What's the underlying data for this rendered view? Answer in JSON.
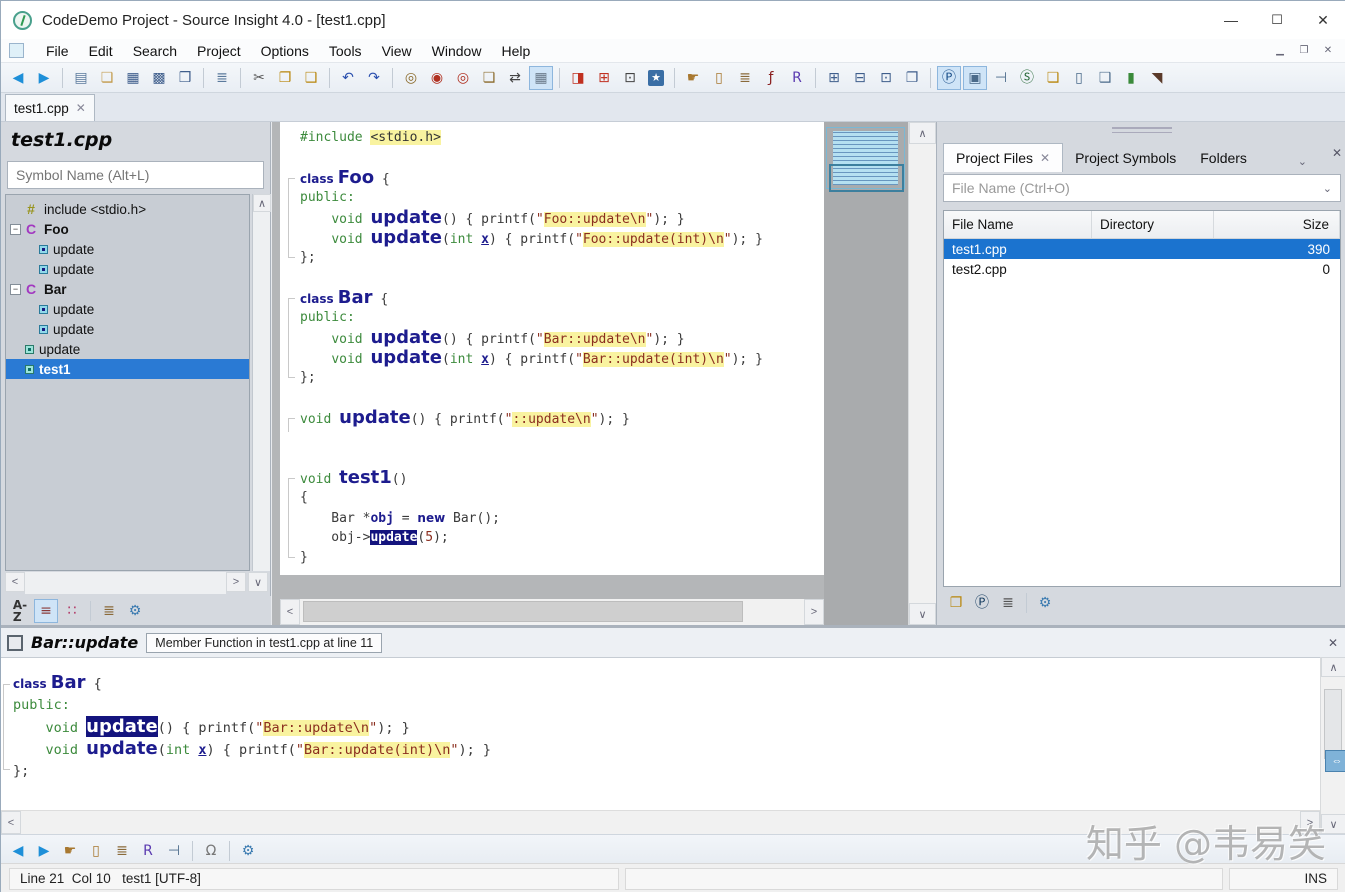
{
  "window": {
    "title": "CodeDemo Project - Source Insight 4.0 - [test1.cpp]",
    "minimize": "—",
    "maximize": "❐",
    "close": "✕",
    "mdi_minimize": "▁",
    "mdi_restore": "❐",
    "mdi_close": "✕"
  },
  "menu": {
    "items": [
      "File",
      "Edit",
      "Search",
      "Project",
      "Options",
      "Tools",
      "View",
      "Window",
      "Help"
    ]
  },
  "toolbar": {
    "items": [
      {
        "n": "nav-back",
        "g": "◀",
        "c": "#1e8fd8"
      },
      {
        "n": "nav-forward",
        "g": "▶",
        "c": "#1e8fd8"
      },
      {
        "sep": true
      },
      {
        "n": "new-file",
        "g": "▤",
        "c": "#5b7a9c"
      },
      {
        "n": "open-file",
        "g": "❏",
        "c": "#c29a4a"
      },
      {
        "n": "save",
        "g": "▦",
        "c": "#3f5e8c"
      },
      {
        "n": "save-as",
        "g": "▩",
        "c": "#3f5e8c"
      },
      {
        "n": "save-all",
        "g": "❒",
        "c": "#3f5e8c"
      },
      {
        "sep": true
      },
      {
        "n": "print",
        "g": "≣",
        "c": "#5b7a9c"
      },
      {
        "sep": true
      },
      {
        "n": "cut",
        "g": "✂",
        "c": "#555555"
      },
      {
        "n": "copy",
        "g": "❐",
        "c": "#b8860b"
      },
      {
        "n": "paste",
        "g": "❑",
        "c": "#b8860b"
      },
      {
        "sep": true
      },
      {
        "n": "undo",
        "g": "↶",
        "c": "#2a4fae"
      },
      {
        "n": "redo",
        "g": "↷",
        "c": "#2a4fae"
      },
      {
        "sep": true
      },
      {
        "n": "search",
        "g": "◎",
        "c": "#8a6a2a"
      },
      {
        "n": "search-forward",
        "g": "◉",
        "c": "#b03020"
      },
      {
        "n": "search-backward",
        "g": "◎",
        "c": "#b03020"
      },
      {
        "n": "search-files",
        "g": "❏",
        "c": "#8a6a2a"
      },
      {
        "n": "replace",
        "g": "⇄",
        "c": "#444444"
      },
      {
        "n": "search-project",
        "g": "▦",
        "c": "#6a7a8a",
        "pr": true
      },
      {
        "sep": true
      },
      {
        "n": "compare-files",
        "g": "◨",
        "c": "#c03020"
      },
      {
        "n": "jump-to-definition",
        "g": "⊞",
        "c": "#c03020"
      },
      {
        "n": "toggle-pane",
        "g": "⊡",
        "c": "#444444"
      },
      {
        "n": "bookmark",
        "g": "★",
        "c": "#ffffff",
        "bg": "#3a6ea5"
      },
      {
        "sep": true
      },
      {
        "n": "context-jump",
        "g": "☛",
        "c": "#a87830"
      },
      {
        "n": "browse-symbols",
        "g": "▯",
        "c": "#a87830"
      },
      {
        "n": "references",
        "g": "≣",
        "c": "#8a6a3a"
      },
      {
        "n": "function-list",
        "g": "ƒ",
        "c": "#8a2020"
      },
      {
        "n": "relation-window",
        "g": "R",
        "c": "#5a3ab0"
      },
      {
        "sep": true
      },
      {
        "n": "window-tile",
        "g": "⊞",
        "c": "#3f5e8c"
      },
      {
        "n": "window-horizontal",
        "g": "⊟",
        "c": "#3f5e8c"
      },
      {
        "n": "window-split",
        "g": "⊡",
        "c": "#3f5e8c"
      },
      {
        "n": "window-cascade",
        "g": "❐",
        "c": "#3f5e8c"
      },
      {
        "sep": true
      },
      {
        "n": "project-window",
        "g": "Ⓟ",
        "c": "#1a4f8a",
        "pr": true
      },
      {
        "n": "context-window",
        "g": "▣",
        "c": "#4a6a8a",
        "pr": true
      },
      {
        "n": "relation-tree",
        "g": "⊣",
        "c": "#4a6a8a"
      },
      {
        "n": "symbol-window",
        "g": "Ⓢ",
        "c": "#2a6a3a"
      },
      {
        "n": "project-file-browser",
        "g": "❏",
        "c": "#b8860b"
      },
      {
        "n": "help-browser",
        "g": "▯",
        "c": "#4a6a8a"
      },
      {
        "n": "clip-window",
        "g": "❑",
        "c": "#4a6a8a"
      },
      {
        "n": "compile-window",
        "g": "▮",
        "c": "#3a8a3a"
      },
      {
        "n": "macro-run",
        "g": "◥",
        "c": "#5a3a2a"
      }
    ]
  },
  "tabstrip": {
    "active_tab": "test1.cpp",
    "close_glyph": "✕"
  },
  "left_panel": {
    "title": "test1.cpp",
    "search_placeholder": "Symbol Name (Alt+L)",
    "tree": [
      {
        "icon": "include",
        "label": "include <stdio.h>",
        "indent": 1
      },
      {
        "icon": "class",
        "label": "Foo",
        "bold": true,
        "expand": "−",
        "indent": 0
      },
      {
        "icon": "method",
        "label": "update",
        "indent": 2
      },
      {
        "icon": "method",
        "label": "update",
        "indent": 2
      },
      {
        "icon": "class",
        "label": "Bar",
        "bold": true,
        "expand": "−",
        "indent": 0
      },
      {
        "icon": "method",
        "label": "update",
        "indent": 2
      },
      {
        "icon": "method",
        "label": "update",
        "indent": 2
      },
      {
        "icon": "func",
        "label": "update",
        "indent": 1
      },
      {
        "icon": "func",
        "label": "test1",
        "indent": 1,
        "selected": true
      }
    ],
    "footer_icons": [
      {
        "n": "sort-alpha",
        "g": "A-Z",
        "c": "#333333",
        "az": true
      },
      {
        "n": "view-list",
        "g": "≡",
        "c": "#8a3a3a",
        "pr": true
      },
      {
        "n": "view-members",
        "g": "∷",
        "c": "#b03060"
      },
      {
        "sep": true
      },
      {
        "n": "browse-book",
        "g": "≣",
        "c": "#8a6a3a"
      },
      {
        "n": "panel-settings",
        "g": "⚙",
        "c": "#3a7ab0"
      }
    ]
  },
  "editor": {
    "lines": [
      [
        {
          "c": "pre",
          "t": "#include "
        },
        {
          "c": "inc",
          "t": "<stdio.h>"
        }
      ],
      [],
      [
        {
          "c": "kw",
          "t": "class "
        },
        {
          "c": "fn",
          "t": "Foo"
        },
        {
          "c": "p",
          "t": " {"
        }
      ],
      [
        {
          "c": "g",
          "t": "public:"
        }
      ],
      [
        {
          "c": "p",
          "t": "    "
        },
        {
          "c": "g",
          "t": "void "
        },
        {
          "c": "fn",
          "t": "update"
        },
        {
          "c": "p",
          "t": "() { printf("
        },
        {
          "c": "s",
          "t": "\""
        },
        {
          "c": "sy",
          "t": "Foo::update\\n"
        },
        {
          "c": "s",
          "t": "\""
        },
        {
          "c": "p",
          "t": "); }"
        }
      ],
      [
        {
          "c": "p",
          "t": "    "
        },
        {
          "c": "g",
          "t": "void "
        },
        {
          "c": "fn",
          "t": "update"
        },
        {
          "c": "p",
          "t": "("
        },
        {
          "c": "g",
          "t": "int "
        },
        {
          "c": "u",
          "t": "x"
        },
        {
          "c": "p",
          "t": ") { printf("
        },
        {
          "c": "s",
          "t": "\""
        },
        {
          "c": "sy",
          "t": "Foo::update(int)\\n"
        },
        {
          "c": "s",
          "t": "\""
        },
        {
          "c": "p",
          "t": "); }"
        }
      ],
      [
        {
          "c": "p",
          "t": "};"
        }
      ],
      [],
      [
        {
          "c": "kw",
          "t": "class "
        },
        {
          "c": "fn",
          "t": "Bar"
        },
        {
          "c": "p",
          "t": " {"
        }
      ],
      [
        {
          "c": "g",
          "t": "public:"
        }
      ],
      [
        {
          "c": "p",
          "t": "    "
        },
        {
          "c": "g",
          "t": "void "
        },
        {
          "c": "fn",
          "t": "update"
        },
        {
          "c": "p",
          "t": "() { printf("
        },
        {
          "c": "s",
          "t": "\""
        },
        {
          "c": "sy",
          "t": "Bar::update\\n"
        },
        {
          "c": "s",
          "t": "\""
        },
        {
          "c": "p",
          "t": "); }"
        }
      ],
      [
        {
          "c": "p",
          "t": "    "
        },
        {
          "c": "g",
          "t": "void "
        },
        {
          "c": "fn",
          "t": "update"
        },
        {
          "c": "p",
          "t": "("
        },
        {
          "c": "g",
          "t": "int "
        },
        {
          "c": "u",
          "t": "x"
        },
        {
          "c": "p",
          "t": ") { printf("
        },
        {
          "c": "s",
          "t": "\""
        },
        {
          "c": "sy",
          "t": "Bar::update(int)\\n"
        },
        {
          "c": "s",
          "t": "\""
        },
        {
          "c": "p",
          "t": "); }"
        }
      ],
      [
        {
          "c": "p",
          "t": "};"
        }
      ],
      [],
      [
        {
          "c": "g",
          "t": "void "
        },
        {
          "c": "fn",
          "t": "update"
        },
        {
          "c": "p",
          "t": "() { printf("
        },
        {
          "c": "s",
          "t": "\""
        },
        {
          "c": "sy",
          "t": "::update\\n"
        },
        {
          "c": "s",
          "t": "\""
        },
        {
          "c": "p",
          "t": "); }"
        }
      ],
      [],
      [],
      [
        {
          "c": "g",
          "t": "void "
        },
        {
          "c": "fn",
          "t": "test1"
        },
        {
          "c": "p",
          "t": "()"
        }
      ],
      [
        {
          "c": "p",
          "t": "{"
        }
      ],
      [
        {
          "c": "p",
          "t": "    Bar *"
        },
        {
          "c": "b",
          "t": "obj"
        },
        {
          "c": "p",
          "t": " = "
        },
        {
          "c": "kw",
          "t": "new"
        },
        {
          "c": "p",
          "t": " Bar();"
        }
      ],
      [
        {
          "c": "p",
          "t": "    obj->"
        },
        {
          "c": "sel",
          "t": "update"
        },
        {
          "c": "p",
          "t": "("
        },
        {
          "c": "n",
          "t": "5"
        },
        {
          "c": "p",
          "t": ");"
        }
      ],
      [
        {
          "c": "p",
          "t": "}"
        }
      ]
    ]
  },
  "right_panel": {
    "tabs": [
      {
        "label": "Project Files",
        "active": true,
        "closable": true
      },
      {
        "label": "Project Symbols"
      },
      {
        "label": "Folders"
      }
    ],
    "tab_chevron": "⌄",
    "close_glyph": "✕",
    "file_input_placeholder": "File Name (Ctrl+O)",
    "input_chevron": "⌄",
    "table": {
      "columns": [
        "File Name",
        "Directory",
        "Size"
      ],
      "rows": [
        {
          "file": "test1.cpp",
          "dir": "",
          "size": "390",
          "selected": true
        },
        {
          "file": "test2.cpp",
          "dir": "",
          "size": "0"
        }
      ]
    },
    "footer_icons": [
      {
        "n": "open-project",
        "g": "❐",
        "c": "#b8860b"
      },
      {
        "n": "add-project-file",
        "g": "Ⓟ",
        "c": "#123a5e"
      },
      {
        "n": "file-list",
        "g": "≣",
        "c": "#555555"
      },
      {
        "sep": true
      },
      {
        "n": "panel-settings",
        "g": "⚙",
        "c": "#3a7ab0"
      }
    ]
  },
  "context_panel": {
    "symbol": "Bar::update",
    "description": "Member Function in test1.cpp at line 11",
    "close_glyph": "✕",
    "lines": [
      [
        {
          "c": "kw",
          "t": "class "
        },
        {
          "c": "fn",
          "t": "Bar"
        },
        {
          "c": "p",
          "t": " {"
        }
      ],
      [
        {
          "c": "g",
          "t": "public:"
        }
      ],
      [
        {
          "c": "p",
          "t": "    "
        },
        {
          "c": "g",
          "t": "void "
        },
        {
          "c": "fnsel",
          "t": "update"
        },
        {
          "c": "p",
          "t": "() { printf("
        },
        {
          "c": "s",
          "t": "\""
        },
        {
          "c": "sy",
          "t": "Bar::update\\n"
        },
        {
          "c": "s",
          "t": "\""
        },
        {
          "c": "p",
          "t": "); }"
        }
      ],
      [
        {
          "c": "p",
          "t": "    "
        },
        {
          "c": "g",
          "t": "void "
        },
        {
          "c": "fn",
          "t": "update"
        },
        {
          "c": "p",
          "t": "("
        },
        {
          "c": "g",
          "t": "int "
        },
        {
          "c": "u",
          "t": "x"
        },
        {
          "c": "p",
          "t": ") { printf("
        },
        {
          "c": "s",
          "t": "\""
        },
        {
          "c": "sy",
          "t": "Bar::update(int)\\n"
        },
        {
          "c": "s",
          "t": "\""
        },
        {
          "c": "p",
          "t": "); }"
        }
      ],
      [
        {
          "c": "p",
          "t": "};"
        }
      ]
    ],
    "toolbar_icons": [
      {
        "n": "ctx-back",
        "g": "◀",
        "c": "#1e8fd8"
      },
      {
        "n": "ctx-forward",
        "g": "▶",
        "c": "#1e8fd8"
      },
      {
        "n": "ctx-jump",
        "g": "☛",
        "c": "#a87830"
      },
      {
        "n": "ctx-browse",
        "g": "▯",
        "c": "#a87830"
      },
      {
        "n": "ctx-references",
        "g": "≣",
        "c": "#8a6a3a"
      },
      {
        "n": "ctx-relation",
        "g": "R",
        "c": "#5a3ab0"
      },
      {
        "n": "ctx-tree",
        "g": "⊣",
        "c": "#4a6a8a"
      },
      {
        "sep": true
      },
      {
        "n": "ctx-lock",
        "g": "Ω",
        "c": "#777777"
      },
      {
        "sep": true
      },
      {
        "n": "ctx-settings",
        "g": "⚙",
        "c": "#3a7ab0"
      }
    ]
  },
  "scrollbar_glyphs": {
    "up": "∧",
    "down": "∨",
    "left": "<",
    "right": ">",
    "grab": "⇔"
  },
  "status_bar": {
    "position": "Line 21  Col 10   test1 [UTF-8]",
    "mode": "INS"
  },
  "watermark": "知乎 @韦易笑"
}
